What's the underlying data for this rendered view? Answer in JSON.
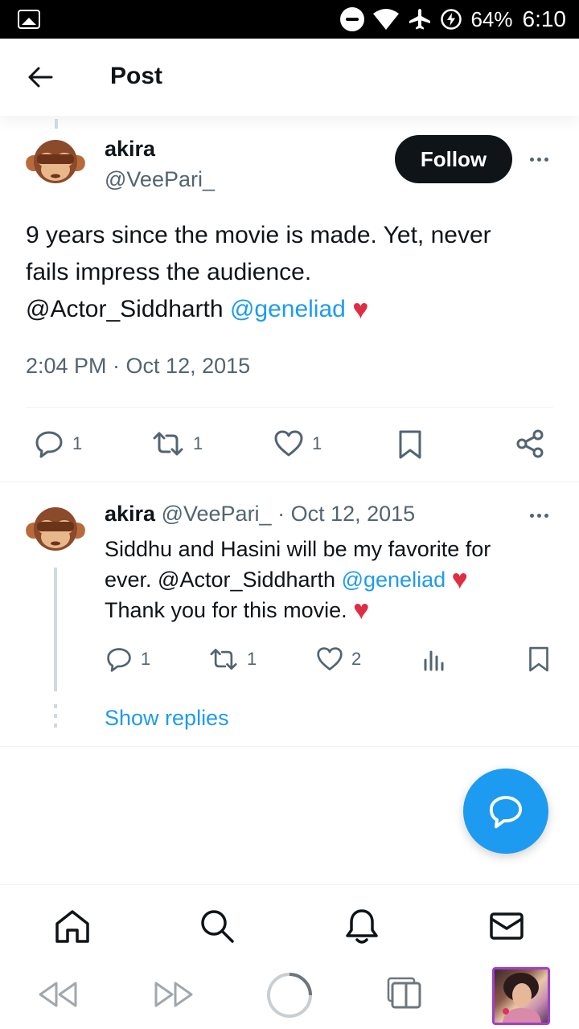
{
  "status_bar": {
    "battery": "64%",
    "time": "6:10"
  },
  "header": {
    "title": "Post"
  },
  "main_post": {
    "author_name": "akira",
    "author_handle": "@VeePari_",
    "follow_label": "Follow",
    "text_line1": "9 years since the movie is made. Yet, never",
    "text_line2": "fails impress the audience.",
    "mention1": "@Actor_Siddharth",
    "mention2": "@geneliad",
    "emoji": "♥",
    "timestamp": "2:04 PM · Oct 12, 2015",
    "replies": "1",
    "reposts": "1",
    "likes": "1"
  },
  "reply_post": {
    "author_name": "akira",
    "meta": "@VeePari_ · Oct 12, 2015",
    "text_line1": "Siddhu and Hasini will be my favorite for",
    "text_line2_prefix": "ever. ",
    "mention1": "@Actor_Siddharth",
    "mention2": "@geneliad",
    "text_line3": "Thank you for this movie.",
    "emoji": "♥",
    "replies": "1",
    "reposts": "1",
    "likes": "2",
    "show_replies": "Show replies"
  }
}
